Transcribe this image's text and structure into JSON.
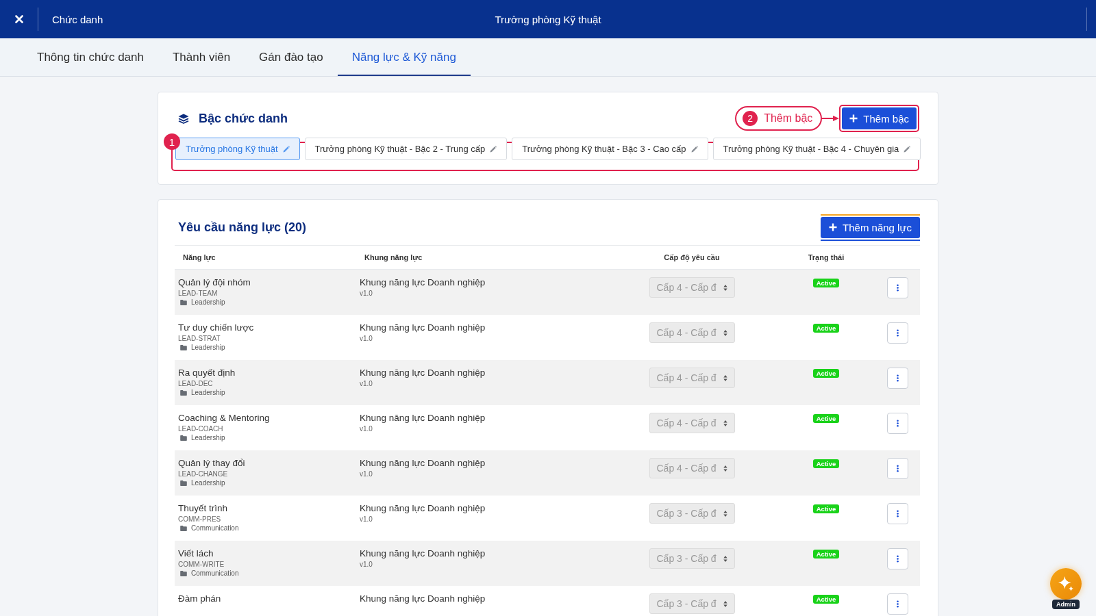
{
  "header": {
    "section": "Chức danh",
    "title": "Trưởng phòng Kỹ thuật"
  },
  "tabs": [
    {
      "label": "Thông tin chức danh",
      "selected": false
    },
    {
      "label": "Thành viên",
      "selected": false
    },
    {
      "label": "Gán đào tạo",
      "selected": false
    },
    {
      "label": "Năng lực & Kỹ năng",
      "selected": true
    }
  ],
  "levels_card": {
    "title": "Bậc chức danh",
    "add_button": {
      "label": "Thêm bậc",
      "annotation": {
        "number": "2",
        "label": "Thêm bậc"
      }
    },
    "levels_annotation": {
      "number": "1"
    },
    "levels": [
      {
        "label": "Trưởng phòng Kỹ thuật",
        "selected": true
      },
      {
        "label": "Trưởng phòng Kỹ thuật - Bậc 2 - Trung cấp",
        "selected": false
      },
      {
        "label": "Trưởng phòng Kỹ thuật - Bậc 3 - Cao cấp",
        "selected": false
      },
      {
        "label": "Trưởng phòng Kỹ thuật - Bậc 4 - Chuyên gia",
        "selected": false
      }
    ]
  },
  "requirements_card": {
    "title": "Yêu cầu năng lực (20)",
    "add_button": {
      "label": "Thêm năng lực"
    },
    "table": {
      "columns": [
        "Năng lực",
        "Khung năng lực",
        "Cấp độ yêu cầu",
        "Trạng thái"
      ],
      "rows": [
        {
          "name": "Quản lý đội nhóm",
          "code": "LEAD-TEAM",
          "category": "Leadership",
          "framework": "Khung năng lực Doanh nghiệp",
          "version": "v1.0",
          "required_level": {
            "value": "Cấp 4 - Cấp đ",
            "disabled": true
          },
          "status": "Active"
        },
        {
          "name": "Tư duy chiến lược",
          "code": "LEAD-STRAT",
          "category": "Leadership",
          "framework": "Khung năng lực Doanh nghiệp",
          "version": "v1.0",
          "required_level": {
            "value": "Cấp 4 - Cấp đ",
            "disabled": true
          },
          "status": "Active"
        },
        {
          "name": "Ra quyết định",
          "code": "LEAD-DEC",
          "category": "Leadership",
          "framework": "Khung năng lực Doanh nghiệp",
          "version": "v1.0",
          "required_level": {
            "value": "Cấp 4 - Cấp đ",
            "disabled": true
          },
          "status": "Active"
        },
        {
          "name": "Coaching & Mentoring",
          "code": "LEAD-COACH",
          "category": "Leadership",
          "framework": "Khung năng lực Doanh nghiệp",
          "version": "v1.0",
          "required_level": {
            "value": "Cấp 4 - Cấp đ",
            "disabled": true
          },
          "status": "Active"
        },
        {
          "name": "Quản lý thay đổi",
          "code": "LEAD-CHANGE",
          "category": "Leadership",
          "framework": "Khung năng lực Doanh nghiệp",
          "version": "v1.0",
          "required_level": {
            "value": "Cấp 4 - Cấp đ",
            "disabled": true
          },
          "status": "Active"
        },
        {
          "name": "Thuyết trình",
          "code": "COMM-PRES",
          "category": "Communication",
          "framework": "Khung năng lực Doanh nghiệp",
          "version": "v1.0",
          "required_level": {
            "value": "Cấp 3 - Cấp đ",
            "disabled": true
          },
          "status": "Active"
        },
        {
          "name": "Viết lách",
          "code": "COMM-WRITE",
          "category": "Communication",
          "framework": "Khung năng lực Doanh nghiệp",
          "version": "v1.0",
          "required_level": {
            "value": "Cấp 3 - Cấp đ",
            "disabled": true
          },
          "status": "Active"
        },
        {
          "name": "Đàm phán",
          "framework": "Khung năng lực Doanh nghiệp",
          "required_level": {
            "value": "Cấp 3 - Cấp đ",
            "disabled": true
          },
          "status": "Active"
        }
      ]
    }
  },
  "assistant_button": {
    "label": "Admin"
  }
}
